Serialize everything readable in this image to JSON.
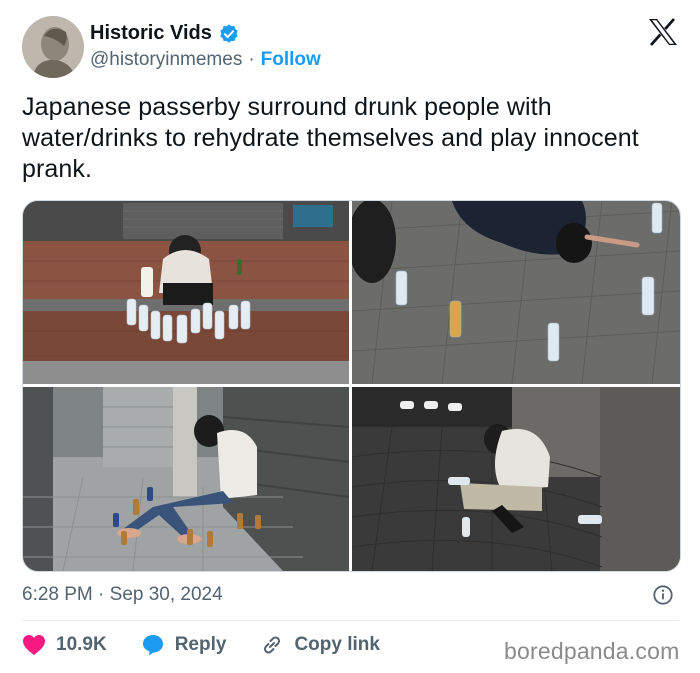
{
  "author": {
    "name": "Historic Vids",
    "handle": "@historyinmemes",
    "separator": "·",
    "follow_label": "Follow"
  },
  "tweet": {
    "text": "Japanese passerby surround drunk people with water/drinks to rehydrate themselves and play innocent prank.",
    "timestamp": "6:28 PM · Sep 30, 2024"
  },
  "media": {
    "photos": [
      {
        "position": "top-left",
        "icon": "photo"
      },
      {
        "position": "top-right",
        "icon": "photo"
      },
      {
        "position": "bottom-left",
        "icon": "photo"
      },
      {
        "position": "bottom-right",
        "icon": "photo"
      }
    ]
  },
  "actions": {
    "like_count": "10.9K",
    "reply_label": "Reply",
    "copy_link_label": "Copy link"
  },
  "watermark": "boredpanda.com",
  "colors": {
    "accent": "#1d9bf0",
    "like": "#f91880",
    "secondary_text": "#536471"
  }
}
